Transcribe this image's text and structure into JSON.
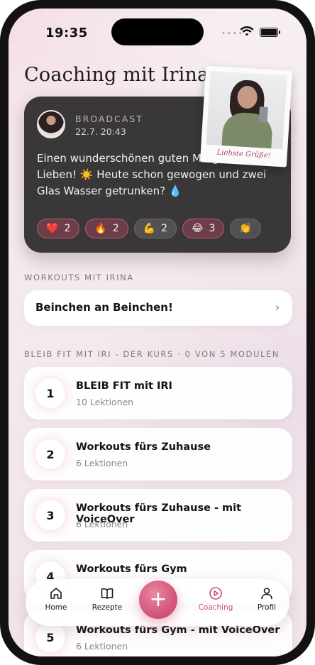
{
  "status": {
    "time": "19:35"
  },
  "header": {
    "title": "Coaching mit Irina"
  },
  "broadcast": {
    "label": "BROADCAST",
    "date": "22.7. 20:43",
    "message": "Einen wunderschönen guten Morgen, meine Lieben! ☀️ Heute schon gewogen und zwei Glas Wasser getrunken? 💧",
    "reactions": [
      {
        "emoji": "❤️",
        "count": "2",
        "active": true
      },
      {
        "emoji": "🔥",
        "count": "2",
        "active": true
      },
      {
        "emoji": "💪",
        "count": "2",
        "active": false
      },
      {
        "emoji": "😂",
        "count": "3",
        "active": true
      },
      {
        "emoji": "👏",
        "count": "",
        "active": false
      }
    ],
    "polaroid_caption": "Liebste Grüße!"
  },
  "workouts": {
    "section_title": "WORKOUTS MIT IRINA",
    "item": "Beinchen an Beinchen!"
  },
  "course": {
    "section_title": "BLEIB FIT MIT IRI - DER KURS · 0 VON 5 MODULEN",
    "modules": [
      {
        "number": "1",
        "title": "BLEIB FIT mit IRI",
        "lessons": "10 Lektionen"
      },
      {
        "number": "2",
        "title": "Workouts fürs Zuhause",
        "lessons": "6 Lektionen"
      },
      {
        "number": "3",
        "title": "Workouts fürs Zuhause - mit VoiceOver",
        "lessons": "6 Lektionen"
      },
      {
        "number": "4",
        "title": "Workouts fürs Gym",
        "lessons": ""
      },
      {
        "number": "5",
        "title": "Workouts fürs Gym - mit VoiceOver",
        "lessons": "6 Lektionen"
      }
    ]
  },
  "tabbar": {
    "home": "Home",
    "recipes": "Rezepte",
    "add": "+",
    "coaching": "Coaching",
    "profile": "Profil",
    "active": "coaching",
    "accent": "#c74f72"
  }
}
